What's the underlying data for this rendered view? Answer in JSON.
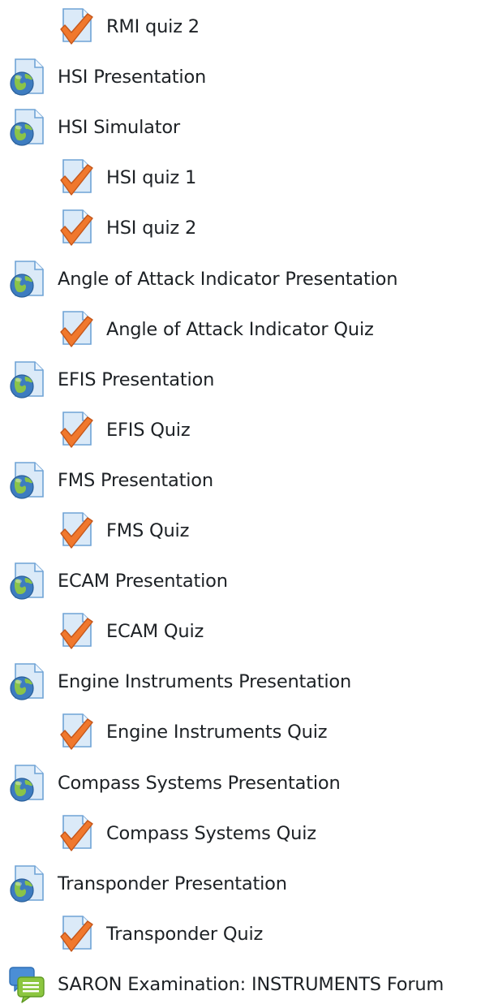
{
  "course_section": {
    "activities": [
      {
        "label": "RMI quiz 2",
        "type": "quiz",
        "icon": "quiz-icon",
        "level": 1
      },
      {
        "label": "HSI Presentation",
        "type": "url",
        "icon": "url-globe-icon",
        "level": 0
      },
      {
        "label": "HSI Simulator",
        "type": "url",
        "icon": "url-globe-icon",
        "level": 0
      },
      {
        "label": "HSI quiz 1",
        "type": "quiz",
        "icon": "quiz-icon",
        "level": 1
      },
      {
        "label": "HSI quiz 2",
        "type": "quiz",
        "icon": "quiz-icon",
        "level": 1
      },
      {
        "label": "Angle of Attack Indicator Presentation",
        "type": "url",
        "icon": "url-globe-icon",
        "level": 0
      },
      {
        "label": "Angle of Attack Indicator Quiz",
        "type": "quiz",
        "icon": "quiz-icon",
        "level": 1
      },
      {
        "label": "EFIS Presentation",
        "type": "url",
        "icon": "url-globe-icon",
        "level": 0
      },
      {
        "label": "EFIS Quiz",
        "type": "quiz",
        "icon": "quiz-icon",
        "level": 1
      },
      {
        "label": "FMS Presentation",
        "type": "url",
        "icon": "url-globe-icon",
        "level": 0
      },
      {
        "label": "FMS Quiz",
        "type": "quiz",
        "icon": "quiz-icon",
        "level": 1
      },
      {
        "label": "ECAM Presentation",
        "type": "url",
        "icon": "url-globe-icon",
        "level": 0
      },
      {
        "label": "ECAM Quiz",
        "type": "quiz",
        "icon": "quiz-icon",
        "level": 1
      },
      {
        "label": "Engine Instruments Presentation",
        "type": "url",
        "icon": "url-globe-icon",
        "level": 0
      },
      {
        "label": "Engine Instruments Quiz",
        "type": "quiz",
        "icon": "quiz-icon",
        "level": 1
      },
      {
        "label": "Compass Systems Presentation",
        "type": "url",
        "icon": "url-globe-icon",
        "level": 0
      },
      {
        "label": "Compass Systems Quiz",
        "type": "quiz",
        "icon": "quiz-icon",
        "level": 1
      },
      {
        "label": "Transponder Presentation",
        "type": "url",
        "icon": "url-globe-icon",
        "level": 0
      },
      {
        "label": "Transponder Quiz",
        "type": "quiz",
        "icon": "quiz-icon",
        "level": 1
      },
      {
        "label": "SARON Examination: INSTRUMENTS Forum",
        "type": "forum",
        "icon": "forum-icon",
        "level": 0
      }
    ]
  },
  "colors": {
    "text": "#1d2125",
    "page_blue": "#cfe3f6",
    "page_outline": "#6fa3d6",
    "check_orange": "#f0782d",
    "globe_blue": "#3d7cc0",
    "globe_green": "#8ac449",
    "forum_green": "#8cc63f"
  }
}
